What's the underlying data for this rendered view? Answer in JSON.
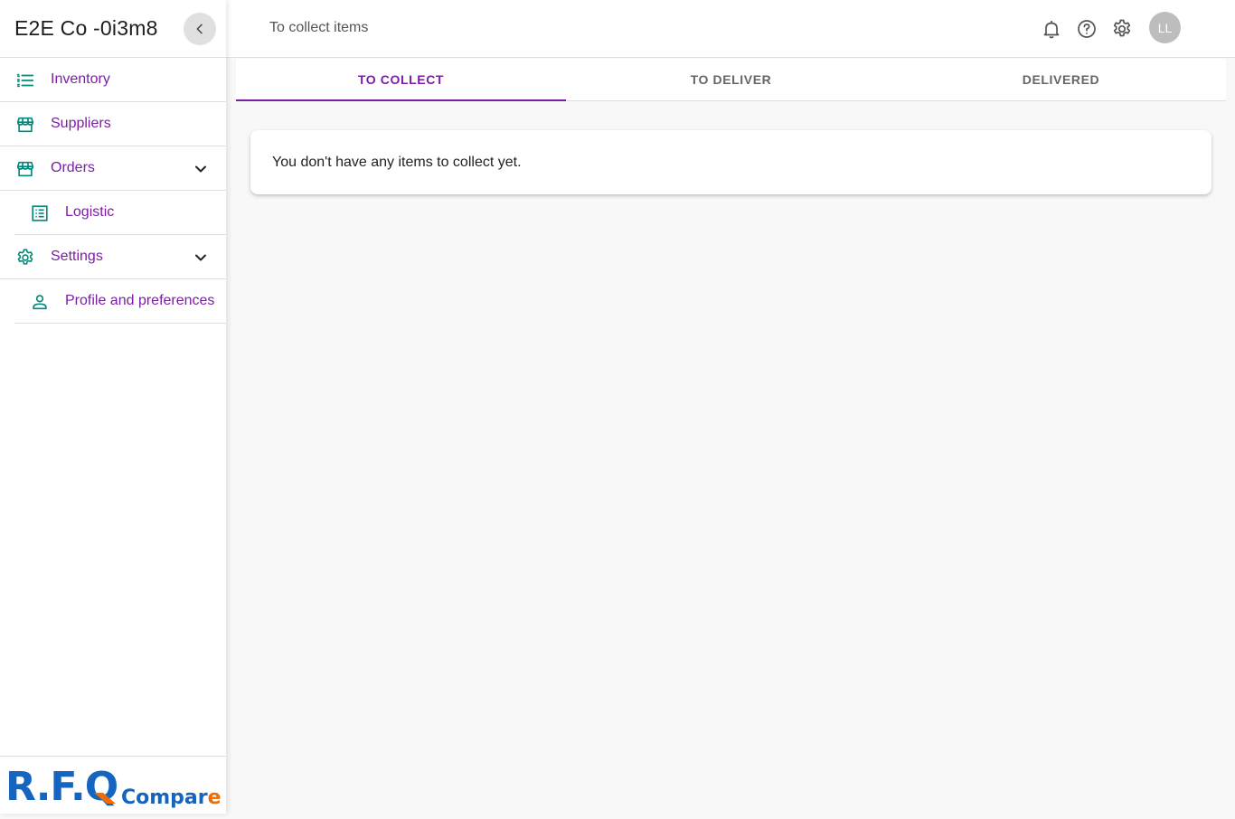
{
  "company": {
    "name": "E2E Co -0i3m8"
  },
  "sidebar": {
    "items": [
      {
        "label": "Inventory",
        "icon": "list-icon"
      },
      {
        "label": "Suppliers",
        "icon": "storefront-icon"
      },
      {
        "label": "Orders",
        "icon": "storefront-icon",
        "expanded": true
      },
      {
        "label": "Logistic",
        "icon": "receipt-list-icon"
      },
      {
        "label": "Settings",
        "icon": "gear-icon",
        "expanded": true
      },
      {
        "label": "Profile and preferences",
        "icon": "person-icon"
      }
    ],
    "logo": {
      "main": "R.F.Q",
      "sub": "Compare"
    }
  },
  "header": {
    "title": "To collect items",
    "avatar_initials": "LL"
  },
  "tabs": [
    {
      "label": "TO COLLECT",
      "active": true
    },
    {
      "label": "TO DELIVER",
      "active": false
    },
    {
      "label": "DELIVERED",
      "active": false
    }
  ],
  "content": {
    "empty_message": "You don't have any items to collect yet."
  },
  "colors": {
    "accent": "#7b1fa2",
    "icon": "#00897b",
    "logo_blue": "#1565c0",
    "logo_orange": "#ef6c00"
  }
}
